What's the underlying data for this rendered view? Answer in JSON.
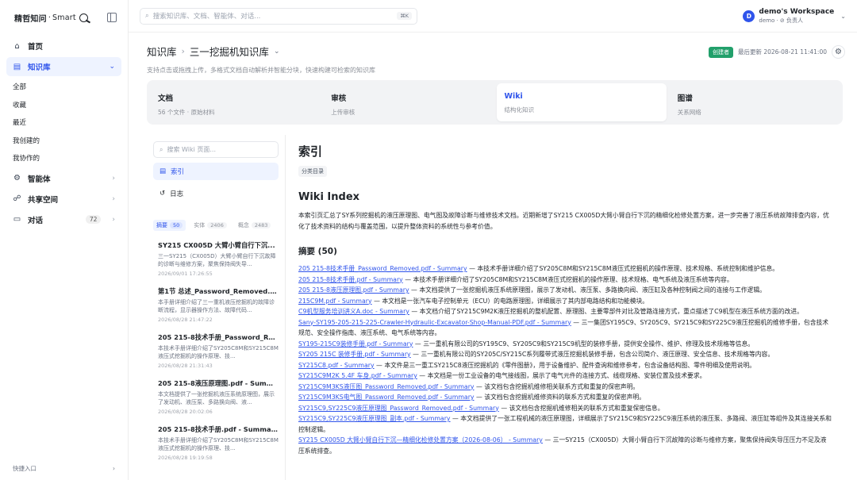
{
  "brand": {
    "logo_cn": "精哲知问",
    "logo_sep": "·",
    "logo_en": "Smart"
  },
  "sidebar": {
    "home": "首页",
    "kb": "知识库",
    "kb_sub": [
      "全部",
      "收藏",
      "最近",
      "我创建的",
      "我协作的"
    ],
    "agents": "智能体",
    "shared": "共享空间",
    "chat": "对话",
    "chat_count": "72",
    "quick_entry": "快捷入口"
  },
  "topbar": {
    "search_placeholder": "搜索知识库、文档、智能体、对话...",
    "shortcut": "⌘K",
    "workspace_initial": "D",
    "workspace_name": "demo's Workspace",
    "workspace_role": "demo · ⊘ 负责人"
  },
  "header": {
    "crumb_root": "知识库",
    "crumb_current": "三一挖掘机知识库",
    "subtitle": "支持点击或拖拽上传，多格式文档自动解析并智能分块，快速构建可检索的知识库",
    "creator_badge": "创建者",
    "last_updated": "最后更新 2026-08-21 11:41:00"
  },
  "tabs": [
    {
      "title": "文档",
      "sub": "56 个文件 · 原始材料"
    },
    {
      "title": "审核",
      "sub": "上传审核"
    },
    {
      "title": "Wiki",
      "sub": "结构化知识"
    },
    {
      "title": "图谱",
      "sub": "关系网络"
    }
  ],
  "wiki_nav": {
    "search_placeholder": "搜索 Wiki 页面...",
    "index": "索引",
    "log": "日志",
    "stats": [
      {
        "label": "摘要",
        "count": "50"
      },
      {
        "label": "实体",
        "count": "2406"
      },
      {
        "label": "概念",
        "count": "2483"
      }
    ],
    "summaries": [
      {
        "title": "SY215 CX005D 大臂小臂自行下沉...",
        "desc": "三一SY215（CX005D）大臂小臂自行下沉故障的诊断与维修方案，聚焦保持阀失导...",
        "date": "2026/09/01 17:26:55"
      },
      {
        "title": "第1节 总述_Password_Removed.pdf...",
        "desc": "本手册详细介绍了三一重机液压挖掘机的故障诊断流程，显示器操作方法、故障代码...",
        "date": "2026/08/28 21:47:22"
      },
      {
        "title": "205 215-8技术手册_Password_Rem...",
        "desc": "本技术手册详细介绍了SY205C8M和SY215C8M液压式挖掘机的操作原理、技...",
        "date": "2026/08/28 21:31:43"
      },
      {
        "title": "205 215-8液压原理图.pdf - Summary",
        "desc": "本文档提供了一张挖掘机液压系统原理图，展示了发动机、液压泵、多路换向阀、液...",
        "date": "2026/08/28 20:02:06"
      },
      {
        "title": "205 215-8技术手册.pdf - Summary",
        "desc": "本技术手册详细介绍了SY205C8M和SY215C8M液压式挖掘机的操作原理、技...",
        "date": "2026/08/28 19:19:58"
      }
    ]
  },
  "wiki": {
    "title": "索引",
    "tag": "分类目录",
    "index_title": "Wiki Index",
    "intro": "本索引页汇总了SY系列挖掘机的液压原理图、电气图及故障诊断与维修技术文档。近期新增了SY215 CX005D大臂小臂自行下沉的精细化检修处置方案，进一步完善了液压系统故障排查内容，优化了技术资料的结构与覆盖范围，以提升整体资料的系统性与参考价值。",
    "summary_heading": "摘要 (50)",
    "links": [
      {
        "link": "205 215-8技术手册_Password_Removed.pdf - Summary",
        "text": " — 本技术手册详细介绍了SY205C8M和SY215C8M液压式挖掘机的操作原理、技术规格、系统控制和维护信息。"
      },
      {
        "link": "205 215-8技术手册.pdf - Summary",
        "text": " — 本技术手册详细介绍了SY205C8M和SY215C8M液压式挖掘机的操作原理、技术规格、电气系统及液压系统等内容。"
      },
      {
        "link": "205 215-8液压原理图.pdf - Summary",
        "text": " — 本文档提供了一张挖掘机液压系统原理图，展示了发动机、液压泵、多路换向阀、液压缸及各种控制阀之间的连接与工作逻辑。"
      },
      {
        "link": "215C9M.pdf - Summary",
        "text": " — 本文档是一张汽车电子控制单元（ECU）的电路原理图，详细展示了其内部电路结构和功能模块。"
      },
      {
        "link": "C9机型服务培训讲义A.doc - Summary",
        "text": " — 本文档介绍了SY215C9M2K液压挖掘机的整机配置、原理图、主要零部件对比及管路连接方式，重点描述了C9机型在液压系统方面的改进。"
      },
      {
        "link": "Sany-SY195-205-215-225-Crawler-Hydraulic-Excavator-Shop-Manual-PDF.pdf - Summary",
        "text": " — 三一集团SY195C9、SY205C9、SY215C9和SY225C9液压挖掘机的维修手册，包含技术规范、安全操作指南、液压系统、电气系统等内容。"
      },
      {
        "link": "SY195-215C9装修手册.pdf - Summary",
        "text": " — 三一重机有限公司的SY195C9、SY205C9和SY215C9机型的装修手册，提供安全操作、维护、修理及技术规格等信息。"
      },
      {
        "link": "SY205 215C 装修手册.pdf - Summary",
        "text": " — 三一重机有限公司的SY205C/SY215C系列履带式液压挖掘机装修手册，包含公司简介、液压原理、安全信息、技术规格等内容。"
      },
      {
        "link": "SY215C8.pdf - Summary",
        "text": " — 本文件是三一重工SY215C8液压挖掘机的《零件图册》，用于设备维护、配件查询和维修参考，包含设备结构图、零件明细及使用说明。"
      },
      {
        "link": "SY215C9M2K 5.4F 车身.pdf - Summary",
        "text": " — 本文档是一份工业设备的电气接线图，展示了电气元件的连接方式、线缆规格、安装位置及技术要求。"
      },
      {
        "link": "SY215C9M3KS液压图_Password_Removed.pdf - Summary",
        "text": " — 该文档包含挖掘机维修相关联系方式和重复的保密声明。"
      },
      {
        "link": "SY215C9M3KS电气图_Password_Removed.pdf - Summary",
        "text": " — 该文档包含挖掘机维修资料的联系方式和重复的保密声明。"
      },
      {
        "link": "SY215C9,SY225C9液压原理图_Password_Removed.pdf - Summary",
        "text": " — 该文档包含挖掘机维修相关的联系方式和重复保密信息。"
      },
      {
        "link": "SY215C9,SY225C9液压原理图_副本.pdf - Summary",
        "text": " — 本文档提供了一张工程机械的液压原理图，详细展示了SY215C9和SY225C9液压系统的液压泵、多路阀、液压缸等组件及其连接关系和控制逻辑。"
      },
      {
        "link": "SY215 CX005D 大臂小臂自行下沉—精细化检修处置方案（2026-08-06） - Summary",
        "text": " — 三一SY215（CX005D）大臂小臂自行下沉故障的诊断与维修方案，聚焦保持阀失导压压力不足及液压系统排查。"
      }
    ]
  },
  "colors": {
    "accent": "#2f54eb",
    "creator_badge": "#22a06b",
    "active_bg": "#eef3ff",
    "tabs_bg": "#f2f3f5"
  }
}
